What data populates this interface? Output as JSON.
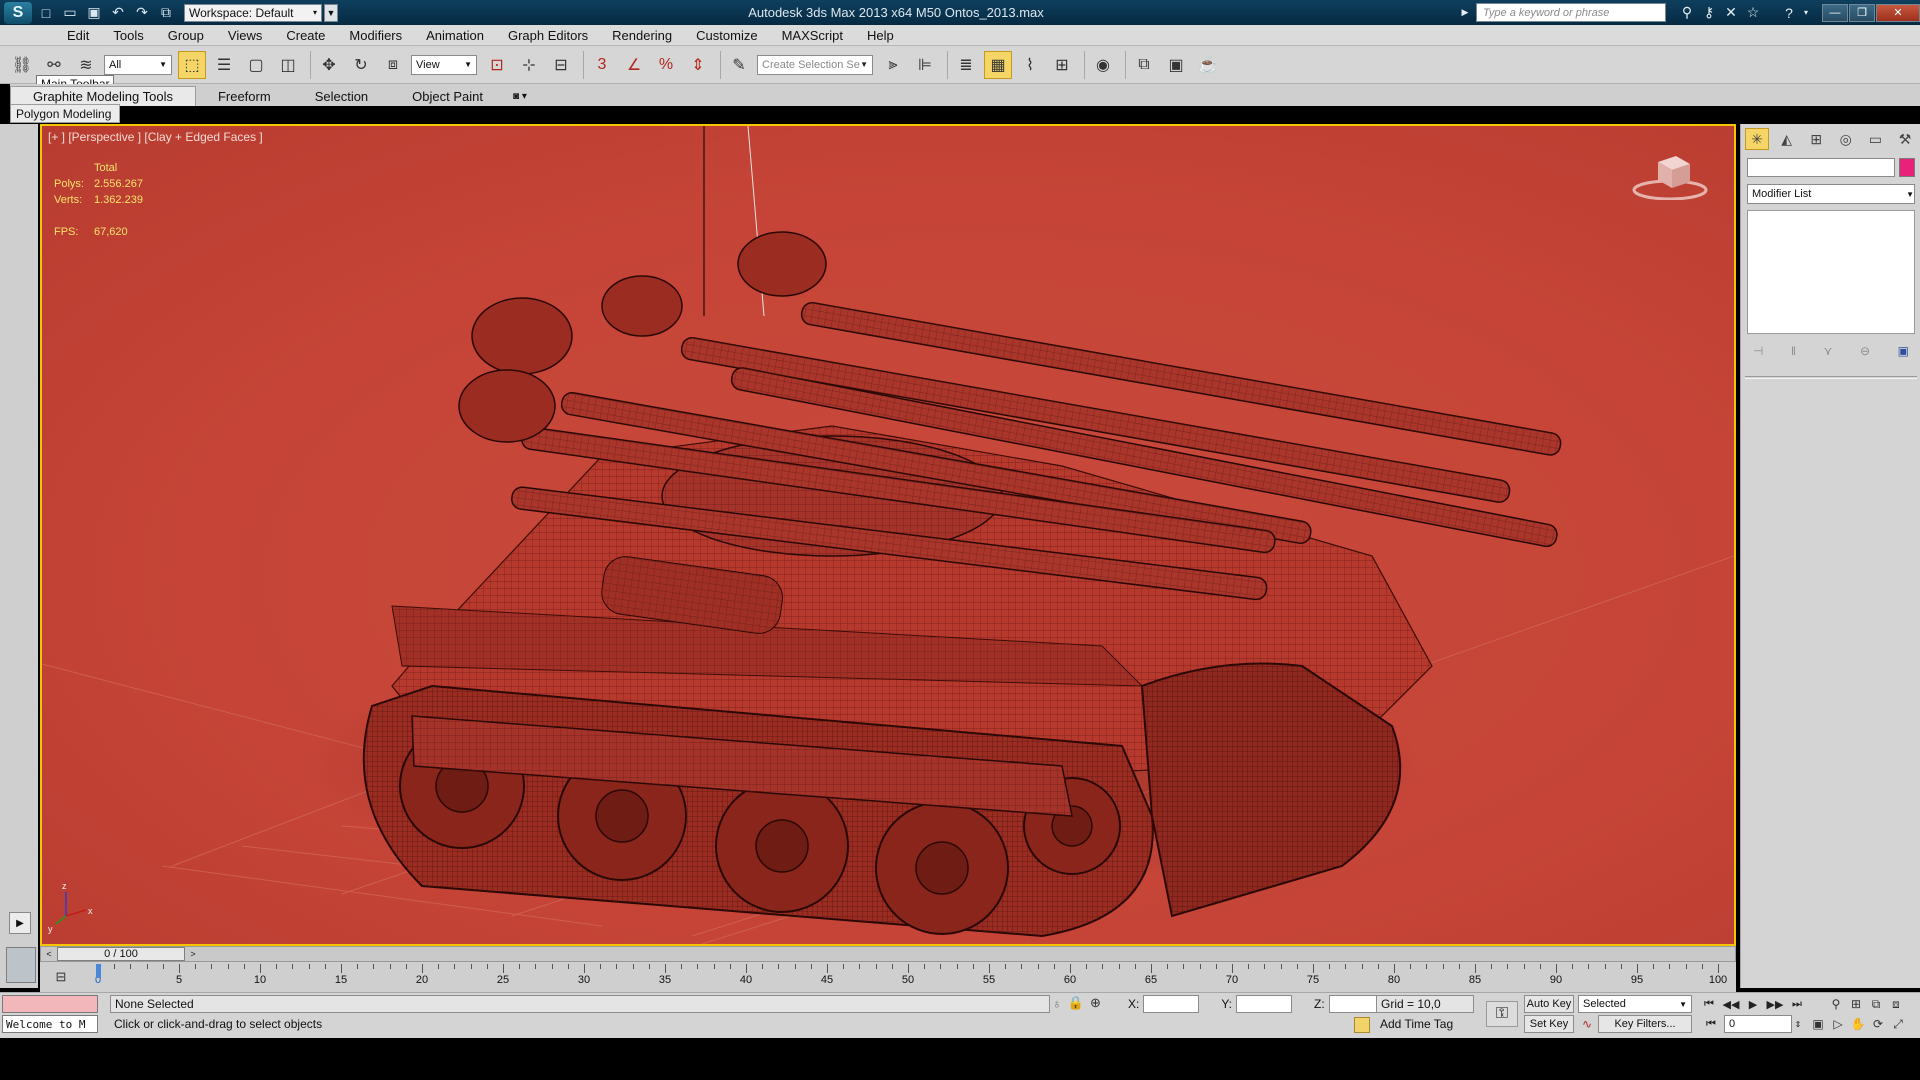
{
  "titlebar": {
    "workspace": "Workspace: Default",
    "window_title": "Autodesk 3ds Max  2013 x64      M50 Ontos_2013.max",
    "search_placeholder": "Type a keyword or phrase"
  },
  "menu": [
    "Edit",
    "Tools",
    "Group",
    "Views",
    "Create",
    "Modifiers",
    "Animation",
    "Graph Editors",
    "Rendering",
    "Customize",
    "MAXScript",
    "Help"
  ],
  "main_toolbar": {
    "selection_filter": "All",
    "ref_coord": "View",
    "named_selection_placeholder": "Create Selection Se",
    "tooltip": "Main Toolbar"
  },
  "ribbon": {
    "tabs": [
      "Graphite Modeling Tools",
      "Freeform",
      "Selection",
      "Object Paint"
    ],
    "panel_label": "Polygon Modeling"
  },
  "viewport": {
    "label": "[+ ] [Perspective ] [Clay + Edged Faces ]",
    "stats_header": "Total",
    "polys_label": "Polys:",
    "polys_value": "2.556.267",
    "verts_label": "Verts:",
    "verts_value": "1.362.239",
    "fps_label": "FPS:",
    "fps_value": "67,620",
    "axis_labels": [
      "z",
      "x",
      "y"
    ]
  },
  "command_panel": {
    "modifier_list": "Modifier List",
    "object_color": "#e8227a"
  },
  "timeslider": {
    "frame_display": "0 / 100",
    "prev": "<",
    "next": ">"
  },
  "trackbar": {
    "ticks": [
      "0",
      "5",
      "10",
      "15",
      "20",
      "25",
      "30",
      "35",
      "40",
      "45",
      "50",
      "55",
      "60",
      "65",
      "70",
      "75",
      "80",
      "85",
      "90",
      "95",
      "100"
    ]
  },
  "status": {
    "maxscript_welcome": "Welcome to M",
    "selection": "None Selected",
    "prompt": "Click or click-and-drag to select objects",
    "x_label": "X:",
    "y_label": "Y:",
    "z_label": "Z:",
    "grid": "Grid = 10,0",
    "add_time_tag": "Add Time Tag",
    "auto_key": "Auto Key",
    "set_key": "Set Key",
    "key_mode": "Selected",
    "key_filters": "Key Filters...",
    "current_frame": "0"
  },
  "colors": {
    "viewport_bg": "#c54437",
    "active_border": "#f6c400",
    "stats_text": "#f7e36a",
    "titlebar": "#0e3f5e"
  }
}
